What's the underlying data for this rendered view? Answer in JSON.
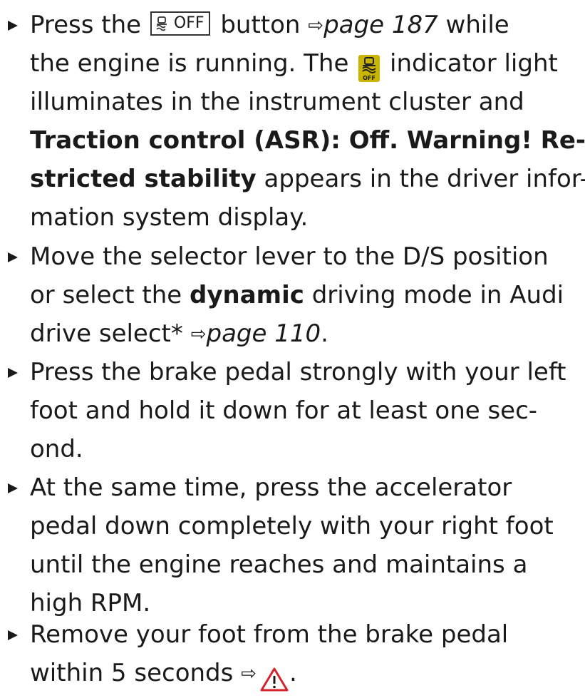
{
  "steps": [
    {
      "l1_a": "Press the ",
      "button_label": "OFF",
      "l1_b": " button ",
      "arrow": "⇨",
      "l1_page": "page 187",
      "l1_c": " while",
      "l2_a": "the engine is running. The ",
      "l2_b": " indicator light",
      "l3": "illuminates in the instrument cluster and",
      "l4_bold": "Traction control (ASR): Off. Warning! Re-",
      "l5_bold": "stricted stability",
      "l5_rest": " appears in the driver infor-",
      "l6": "mation system display."
    },
    {
      "l1": "Move the selector lever to the D/S position",
      "l2_a": "or select the ",
      "l2_bold": "dynamic",
      "l2_b": " driving mode in Audi",
      "l3_a": "drive select* ",
      "arrow": "⇨",
      "l3_page": "page 110",
      "l3_b": "."
    },
    {
      "l1": "Press the brake pedal strongly with your left",
      "l2": "foot and hold it down for at least one sec-",
      "l3": "ond."
    },
    {
      "l1": "At the same time, press the accelerator",
      "l2": "pedal down completely with your right foot",
      "l3": "until the engine reaches and maintains a",
      "l4": "high RPM."
    },
    {
      "l1": "Remove your foot from the brake pedal",
      "l2_a": "within 5 seconds ",
      "arrow": "⇨",
      "l2_b": "."
    }
  ],
  "colors": {
    "text": "#1a1a1a",
    "indicator_bg": "#c9b400",
    "warning_red": "#d3242b"
  },
  "icons": {
    "button_icon": "traction-control-icon",
    "indicator": "traction-control-off-indicator-icon",
    "warning": "warning-triangle-icon"
  }
}
